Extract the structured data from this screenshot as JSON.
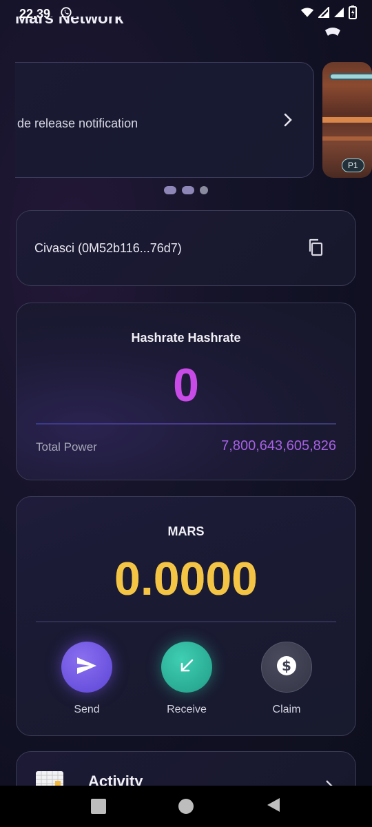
{
  "status_bar": {
    "time": "22.39",
    "icons": [
      "whatsapp-icon",
      "wifi-icon",
      "signal-icon",
      "signal-icon",
      "battery-icon"
    ]
  },
  "header": {
    "title": "Mars Network",
    "icon": "settings-icon"
  },
  "carousel": {
    "banner_text": "de release notification",
    "thumbnail_badge": "P1",
    "page_count": 3
  },
  "wallet": {
    "label": "Civasci (0M52b116...76d7)",
    "copy_icon": "copy-icon"
  },
  "hashrate": {
    "title": "Hashrate Hashrate",
    "value": "0",
    "total_power_label": "Total Power",
    "total_power_value": "7,800,643,605,826",
    "value_color": "#c84be8"
  },
  "mars": {
    "title": "MARS",
    "balance": "0.0000",
    "balance_color": "#f4c545",
    "actions": [
      {
        "label": "Send",
        "icon": "send-icon",
        "color": "#6e55e6"
      },
      {
        "label": "Receive",
        "icon": "receive-arrow-icon",
        "color": "#2fb59d"
      },
      {
        "label": "Claim",
        "icon": "dollar-icon",
        "color": "#3e4052"
      }
    ]
  },
  "activity": {
    "title": "Activity"
  },
  "nav_bar": {
    "buttons": [
      "recents-button",
      "home-button",
      "back-button"
    ]
  }
}
